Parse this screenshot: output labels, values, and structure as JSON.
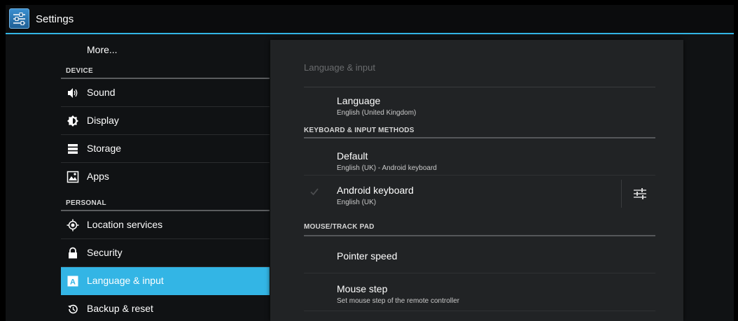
{
  "app": {
    "title": "Settings"
  },
  "sidebar": {
    "more_label": "More...",
    "sections": [
      {
        "header": "DEVICE",
        "items": [
          {
            "label": "Sound",
            "icon": "speaker-icon"
          },
          {
            "label": "Display",
            "icon": "brightness-icon"
          },
          {
            "label": "Storage",
            "icon": "storage-icon"
          },
          {
            "label": "Apps",
            "icon": "apps-icon"
          }
        ]
      },
      {
        "header": "PERSONAL",
        "items": [
          {
            "label": "Location services",
            "icon": "location-icon"
          },
          {
            "label": "Security",
            "icon": "lock-icon"
          },
          {
            "label": "Language & input",
            "icon": "language-icon",
            "selected": true
          },
          {
            "label": "Backup & reset",
            "icon": "backup-icon"
          }
        ]
      }
    ]
  },
  "detail": {
    "page_title": "Language & input",
    "language": {
      "title": "Language",
      "summary": "English (United Kingdom)"
    },
    "keyboard_header": "KEYBOARD & INPUT METHODS",
    "default": {
      "title": "Default",
      "summary": "English (UK) - Android keyboard"
    },
    "android_keyboard": {
      "title": "Android keyboard",
      "summary": "English (UK)",
      "checked": true
    },
    "mouse_header": "MOUSE/TRACK PAD",
    "pointer_speed": {
      "title": "Pointer speed"
    },
    "mouse_step": {
      "title": "Mouse step",
      "summary": "Set mouse step of the remote controller"
    }
  },
  "colors": {
    "accent": "#33b5e5",
    "background": "#101214",
    "panel": "#212325"
  }
}
